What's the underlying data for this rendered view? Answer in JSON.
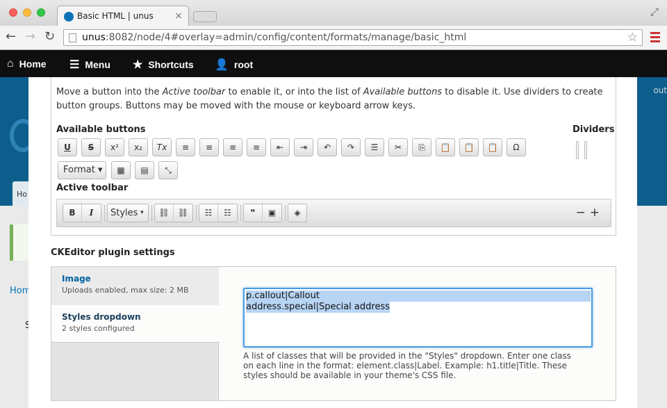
{
  "browser": {
    "tab_title": "Basic HTML | unus",
    "url_host": "unus",
    "url_rest": ":8082/node/4#overlay=admin/config/content/formats/manage/basic_html"
  },
  "toolbar": {
    "home": "Home",
    "menu": "Menu",
    "shortcuts": "Shortcuts",
    "user": "root"
  },
  "background": {
    "tab_fragment": "Ho",
    "logout_fragment": "out",
    "home_fragment": "Home",
    "s_fragment": "S"
  },
  "editor": {
    "desc_1": "Move a button into the ",
    "desc_active": "Active toolbar",
    "desc_2": " to enable it, or into the list of ",
    "desc_available": "Available buttons",
    "desc_3": " to disable it. Use dividers to create button groups. Buttons may be moved with the mouse or keyboard arrow keys.",
    "available_label": "Available buttons",
    "dividers_label": "Dividers",
    "available_buttons": [
      {
        "glyph": "U",
        "icon": "underline-icon"
      },
      {
        "glyph": "S",
        "icon": "strikethrough-icon"
      },
      {
        "glyph": "x²",
        "icon": "superscript-icon"
      },
      {
        "glyph": "x₂",
        "icon": "subscript-icon"
      },
      {
        "glyph": "Tx",
        "icon": "remove-format-icon"
      },
      {
        "glyph": "≡",
        "icon": "align-left-icon"
      },
      {
        "glyph": "≡",
        "icon": "align-center-icon"
      },
      {
        "glyph": "≡",
        "icon": "align-right-icon"
      },
      {
        "glyph": "≡",
        "icon": "justify-icon"
      },
      {
        "glyph": "⇤",
        "icon": "outdent-icon"
      },
      {
        "glyph": "⇥",
        "icon": "indent-icon"
      },
      {
        "glyph": "↶",
        "icon": "undo-icon"
      },
      {
        "glyph": "↷",
        "icon": "redo-icon"
      },
      {
        "glyph": "☰",
        "icon": "horizontal-rule-icon"
      },
      {
        "glyph": "✂",
        "icon": "cut-icon"
      },
      {
        "glyph": "⎘",
        "icon": "copy-icon"
      },
      {
        "glyph": "📋",
        "icon": "paste-icon"
      },
      {
        "glyph": "📋",
        "icon": "paste-text-icon"
      },
      {
        "glyph": "📋",
        "icon": "paste-word-icon"
      },
      {
        "glyph": "Ω",
        "icon": "special-character-icon"
      }
    ],
    "format_label": "Format",
    "active_label": "Active toolbar",
    "active_buttons": {
      "bold": "B",
      "italic": "I",
      "styles": "Styles",
      "link": "⛓",
      "unlink": "⛓",
      "bullet": "☷",
      "numbered": "☷",
      "quote": "❞",
      "image": "▣",
      "source": "◈"
    },
    "minus": "−",
    "plus": "+"
  },
  "plugins": {
    "title": "CKEditor plugin settings",
    "tabs": [
      {
        "title": "Image",
        "summary": "Uploads enabled, max size: 2 MB"
      },
      {
        "title": "Styles dropdown",
        "summary": "2 styles configured"
      }
    ],
    "styles_line1": "p.callout|Callout",
    "styles_line2": "address.special|Special address",
    "help": "A list of classes that will be provided in the \"Styles\" dropdown. Enter one class on each line in the format: element.class|Label. Example: h1.title|Title. These styles should be available in your theme's CSS file."
  }
}
